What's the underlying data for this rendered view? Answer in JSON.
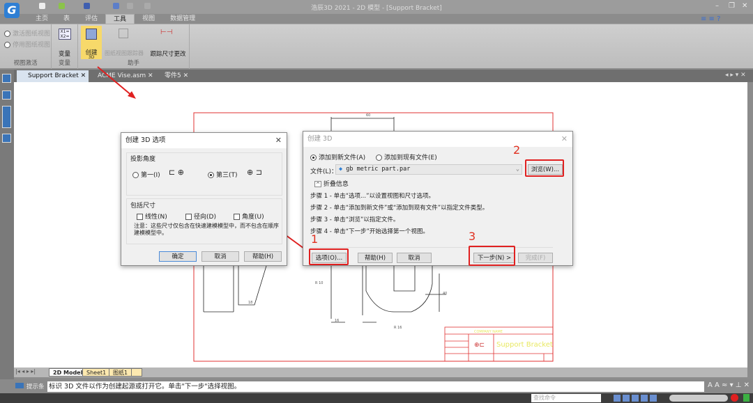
{
  "app": {
    "title": "浩辰3D 2021 - 2D 模型 - [Support Bracket]",
    "logo": "G"
  },
  "ribbon_tabs": [
    {
      "label": "主页"
    },
    {
      "label": "表"
    },
    {
      "label": "评估"
    },
    {
      "label": "工具"
    },
    {
      "label": "视图"
    },
    {
      "label": "数据管理"
    }
  ],
  "ribbon": {
    "view_activate": {
      "items": [
        "激活图纸视图",
        "停用图纸视图"
      ],
      "group": "视图激活"
    },
    "variables": {
      "label": "变量",
      "group": "变量"
    },
    "helpers": {
      "create3d": "创建",
      "create3d_sub": "3D",
      "sheet_view_tracker": "图纸视图跟踪器",
      "track_dim": "跟踪尺寸更改",
      "group": "助手"
    }
  },
  "doc_tabs": [
    {
      "label": "Support Bracket"
    },
    {
      "label": "ACME Vise.asm"
    },
    {
      "label": "零件5"
    }
  ],
  "sheet_tabs": [
    {
      "label": "2D Model"
    },
    {
      "label": "Sheet1"
    },
    {
      "label": "图纸1"
    }
  ],
  "prompt": {
    "label": "提示条",
    "text": "标识 3D 文件以作为创建起源或打开它。单击\"下一步\"选择视图。"
  },
  "status": {
    "command_placeholder": "查找命令"
  },
  "drawing": {
    "title_block_name": "Support Bracket",
    "company": "COMPANY NAME",
    "dims": [
      "R 10",
      "R 16",
      "40",
      "18",
      "16",
      "60"
    ]
  },
  "options_dialog": {
    "title": "创建 3D 选项",
    "projection_label": "投影角度",
    "first": "第一(I)",
    "third": "第三(T)",
    "dims_label": "包括尺寸",
    "linear": "线性(N)",
    "radial": "径向(D)",
    "angular": "角度(U)",
    "note": "注意：这些尺寸仅包含在快速建模模型中，而不包含在顺序建模模型中。",
    "ok": "确定",
    "cancel": "取消",
    "help": "帮助(H)"
  },
  "create_dialog": {
    "title": "创建 3D",
    "new_file": "添加到新文件(A)",
    "existing_file": "添加到现有文件(E)",
    "file_label": "文件(L)：",
    "file_value": "gb metric part.par",
    "browse": "浏览(W)...",
    "collapse": "折叠信息",
    "steps": [
      "步骤 1 - 单击“选项...”以设置视图和尺寸选项。",
      "步骤 2 - 单击“添加到新文件”或“添加到现有文件”以指定文件类型。",
      "步骤 3 - 单击“浏览”以指定文件。",
      "步骤 4 - 单击“下一步”开始选择第一个视图。"
    ],
    "options": "选项(O)...",
    "help": "帮助(H)",
    "cancel": "取消",
    "next": "下一步(N) >",
    "finish": "完成(F)"
  },
  "annotations": [
    "1",
    "2",
    "3"
  ],
  "colors": {
    "highlight": "#e02020",
    "accent": "#2f7fd4"
  }
}
